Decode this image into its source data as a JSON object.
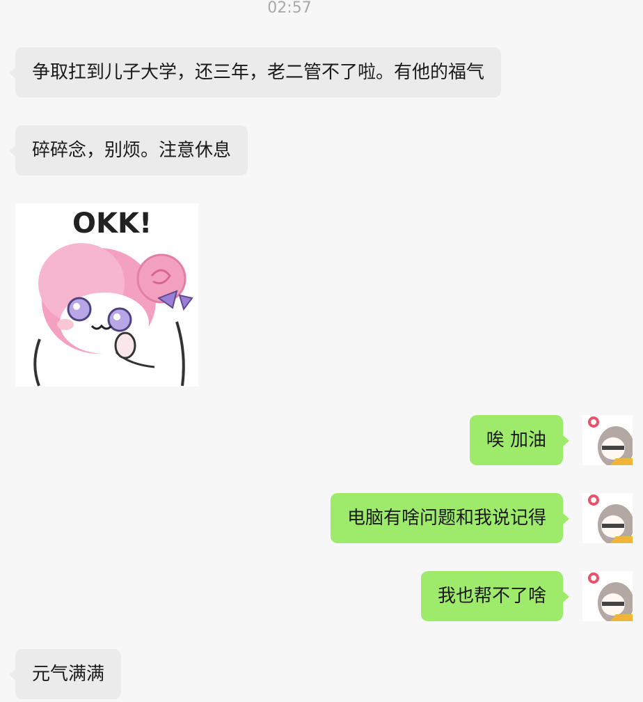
{
  "timestamp": "02:57",
  "messages": [
    {
      "side": "left",
      "type": "text",
      "text": "争取扛到儿子大学，还三年，老二管不了啦。有他的福气"
    },
    {
      "side": "left",
      "type": "text",
      "text": "碎碎念，别烦。注意休息"
    },
    {
      "side": "left",
      "type": "sticker",
      "caption": "OKK!"
    },
    {
      "side": "right",
      "type": "text",
      "text": "唉 加油"
    },
    {
      "side": "right",
      "type": "text",
      "text": "电脑有啥问题和我说记得"
    },
    {
      "side": "right",
      "type": "text",
      "text": "我也帮不了啥"
    },
    {
      "side": "left",
      "type": "text",
      "text": "元气满满"
    }
  ],
  "colors": {
    "background": "#f7f7f7",
    "incoming_bubble": "#ebebeb",
    "outgoing_bubble": "#9eea6a",
    "timestamp_text": "#a8a8a8"
  }
}
